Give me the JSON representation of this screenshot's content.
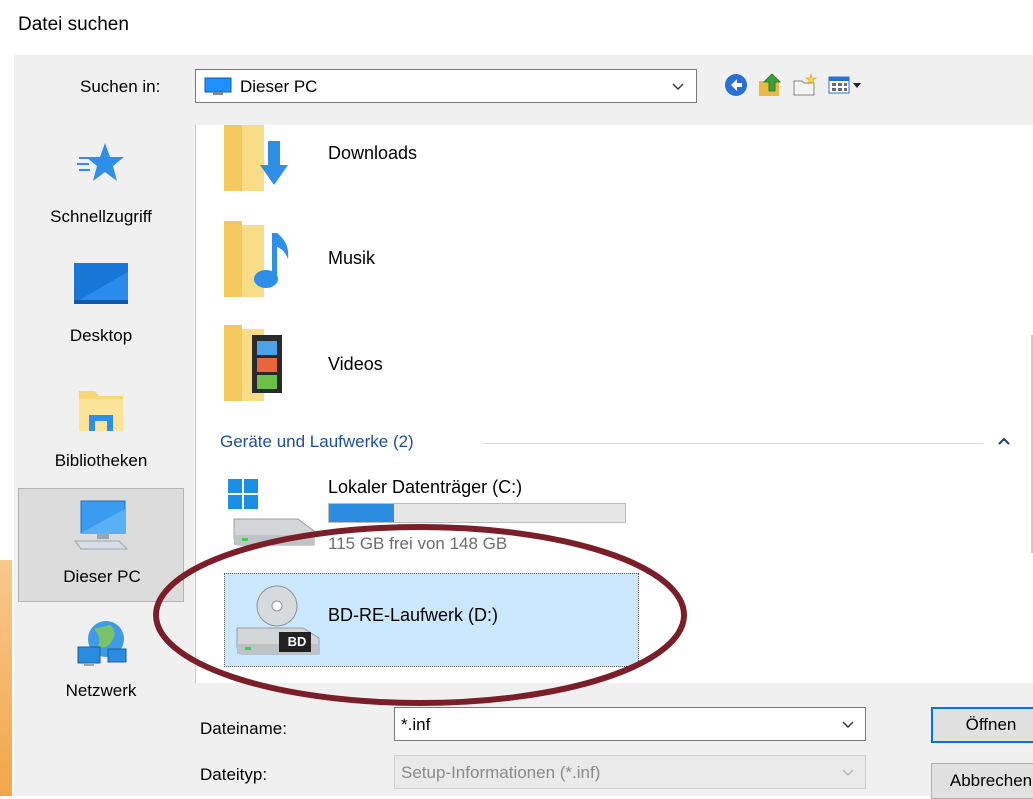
{
  "window": {
    "title": "Datei suchen"
  },
  "toolbar": {
    "look_in_label": "Suchen in:",
    "look_in_value": "Dieser PC",
    "icons": [
      "back-icon",
      "up-folder-icon",
      "new-folder-icon",
      "view-menu-icon"
    ]
  },
  "places": [
    {
      "label": "Schnellzugriff",
      "icon": "star-icon"
    },
    {
      "label": "Desktop",
      "icon": "desktop-icon"
    },
    {
      "label": "Bibliotheken",
      "icon": "libraries-icon"
    },
    {
      "label": "Dieser PC",
      "icon": "computer-icon",
      "selected": true
    },
    {
      "label": "Netzwerk",
      "icon": "network-icon"
    }
  ],
  "files": {
    "folders": [
      {
        "name": "Downloads",
        "icon": "downloads-folder-icon"
      },
      {
        "name": "Musik",
        "icon": "music-folder-icon"
      },
      {
        "name": "Videos",
        "icon": "videos-folder-icon"
      }
    ],
    "group_header": "Geräte und Laufwerke (2)",
    "drives": [
      {
        "name": "Lokaler Datenträger (C:)",
        "free_text": "115 GB frei von 148 GB",
        "used_fraction": 0.22,
        "icon": "windows-drive-icon"
      },
      {
        "name": "BD-RE-Laufwerk (D:)",
        "icon": "bd-drive-icon",
        "badge": "BD",
        "selected": true
      }
    ]
  },
  "bottom": {
    "filename_label": "Dateiname:",
    "filename_value": "*.inf",
    "filetype_label": "Dateityp:",
    "filetype_value": "Setup-Informationen (*.inf)",
    "open_button": "Öffnen",
    "cancel_button": "Abbrechen"
  },
  "colors": {
    "accent": "#0078d7",
    "selection": "#cce8ff",
    "group_header": "#1e4e9a",
    "annotation_ellipse": "#7a1e2a",
    "drive_bar": "#2b8ce0"
  }
}
